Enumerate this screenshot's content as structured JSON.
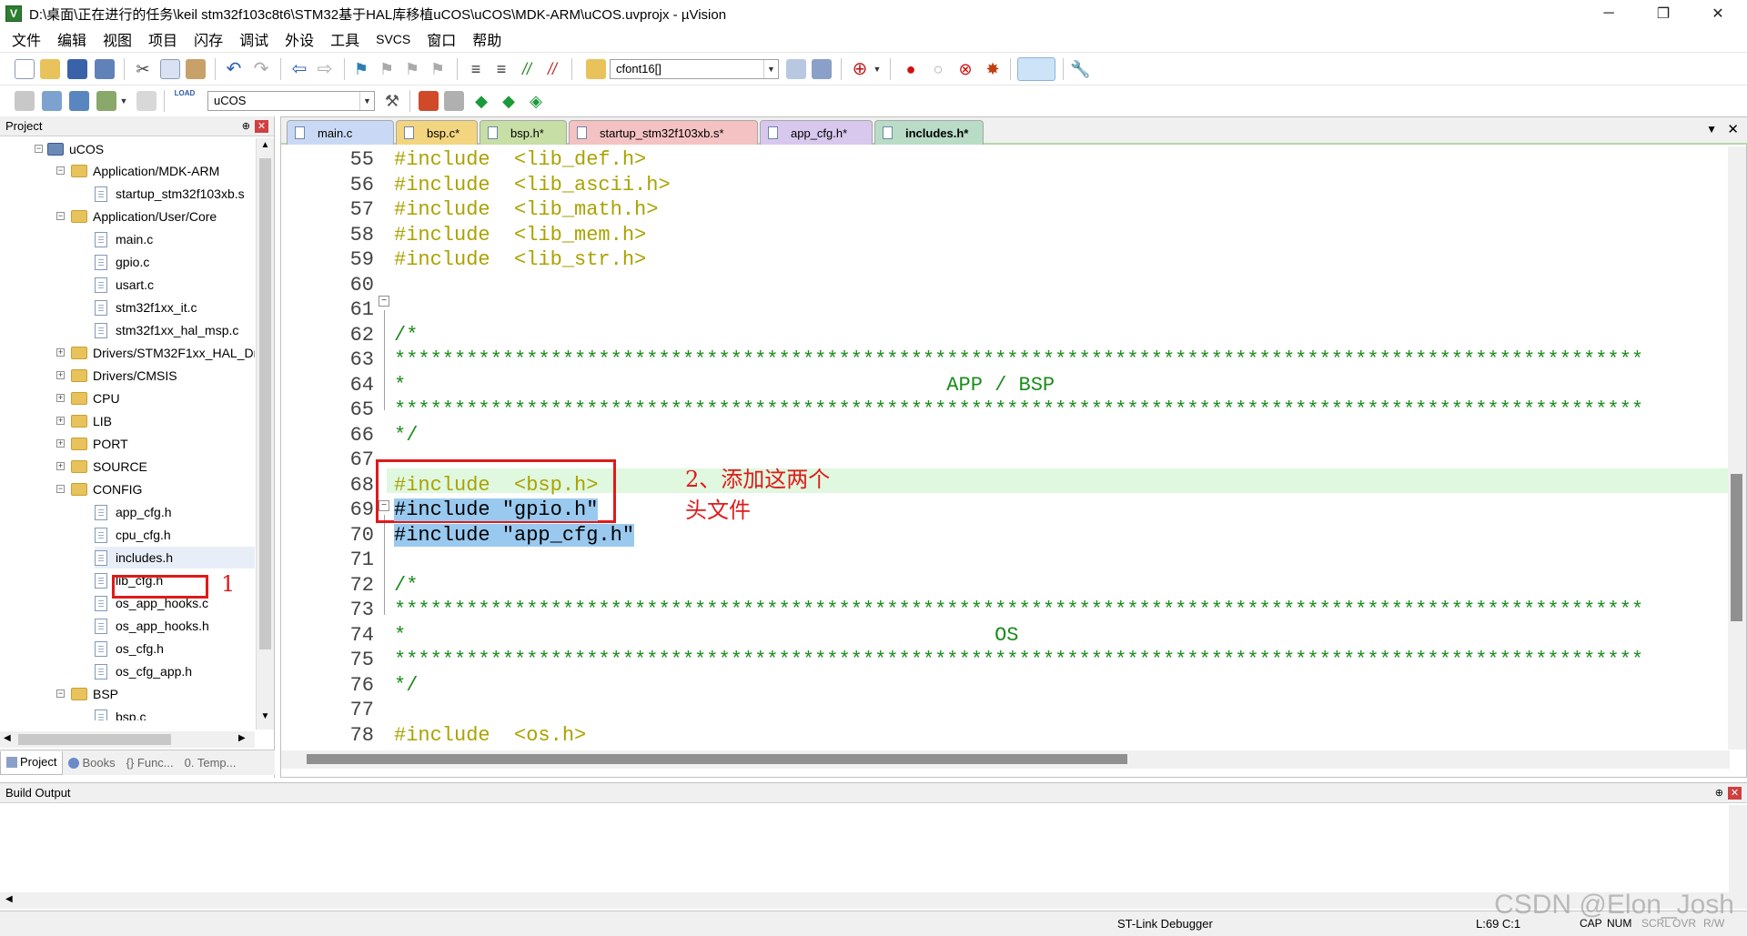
{
  "window": {
    "title": "D:\\桌面\\正在进行的任务\\keil stm32f103c8t6\\STM32基于HAL库移植uCOS\\uCOS\\MDK-ARM\\uCOS.uvprojx - µVision",
    "minimize": "─",
    "restore": "❐",
    "close": "✕"
  },
  "menu": [
    "文件",
    "编辑",
    "视图",
    "项目",
    "闪存",
    "调试",
    "外设",
    "工具",
    "SVCS",
    "窗口",
    "帮助"
  ],
  "toolbar": {
    "find_combo": "cfont16[]",
    "target_combo": "uCOS",
    "load_label": "LOAD"
  },
  "project_panel": {
    "title": "Project",
    "pin": "⊕",
    "close": "✕",
    "root": "uCOS",
    "tree": [
      {
        "type": "folder",
        "label": "Application/MDK-ARM",
        "expanded": true,
        "children": [
          "startup_stm32f103xb.s"
        ]
      },
      {
        "type": "folder",
        "label": "Application/User/Core",
        "expanded": true,
        "children": [
          "main.c",
          "gpio.c",
          "usart.c",
          "stm32f1xx_it.c",
          "stm32f1xx_hal_msp.c"
        ]
      },
      {
        "type": "folder",
        "label": "Drivers/STM32F1xx_HAL_Dr",
        "expanded": false
      },
      {
        "type": "folder",
        "label": "Drivers/CMSIS",
        "expanded": false
      },
      {
        "type": "folder",
        "label": "CPU",
        "expanded": false
      },
      {
        "type": "folder",
        "label": "LIB",
        "expanded": false
      },
      {
        "type": "folder",
        "label": "PORT",
        "expanded": false
      },
      {
        "type": "folder",
        "label": "SOURCE",
        "expanded": false
      },
      {
        "type": "folder",
        "label": "CONFIG",
        "expanded": true,
        "children": [
          "app_cfg.h",
          "cpu_cfg.h",
          "includes.h",
          "lib_cfg.h",
          "os_app_hooks.c",
          "os_app_hooks.h",
          "os_cfg.h",
          "os_cfg_app.h"
        ]
      },
      {
        "type": "folder",
        "label": "BSP",
        "expanded": true,
        "children": [
          "bsp.c"
        ]
      }
    ],
    "tabs": [
      "Project",
      "Books",
      "{} Func...",
      "0. Temp..."
    ]
  },
  "editor": {
    "tabs": [
      {
        "label": "main.c",
        "color": "#c9d9f5"
      },
      {
        "label": "bsp.c*",
        "color": "#f3d57f"
      },
      {
        "label": "bsp.h*",
        "color": "#c7dea6"
      },
      {
        "label": "startup_stm32f103xb.s*",
        "color": "#f4c2c2"
      },
      {
        "label": "app_cfg.h*",
        "color": "#d8c8ee"
      },
      {
        "label": "includes.h*",
        "color": "#b8dcc6",
        "active": true
      }
    ],
    "lines": [
      {
        "n": "55",
        "text": "#include  <lib_def.h>",
        "kind": "inc"
      },
      {
        "n": "56",
        "text": "#include  <lib_ascii.h>",
        "kind": "inc"
      },
      {
        "n": "57",
        "text": "#include  <lib_math.h>",
        "kind": "inc"
      },
      {
        "n": "58",
        "text": "#include  <lib_mem.h>",
        "kind": "inc"
      },
      {
        "n": "59",
        "text": "#include  <lib_str.h>",
        "kind": "inc"
      },
      {
        "n": "60",
        "text": "",
        "kind": "plain"
      },
      {
        "n": "61",
        "text": "",
        "kind": "plain"
      },
      {
        "n": "62",
        "text": "/*",
        "kind": "cmt"
      },
      {
        "n": "63",
        "text": "********************************************************************************************************",
        "kind": "cmt"
      },
      {
        "n": "64",
        "text": "*                                             APP / BSP",
        "kind": "cmt"
      },
      {
        "n": "65",
        "text": "********************************************************************************************************",
        "kind": "cmt"
      },
      {
        "n": "66",
        "text": "*/",
        "kind": "cmt"
      },
      {
        "n": "67",
        "text": "",
        "kind": "plain"
      },
      {
        "n": "68",
        "text": "#include  <bsp.h>",
        "kind": "inc"
      },
      {
        "n": "69",
        "text": "#include \"gpio.h\"",
        "kind": "sel"
      },
      {
        "n": "70",
        "text": "#include \"app_cfg.h\"",
        "kind": "sel"
      },
      {
        "n": "71",
        "text": "",
        "kind": "plain"
      },
      {
        "n": "72",
        "text": "/*",
        "kind": "cmt"
      },
      {
        "n": "73",
        "text": "********************************************************************************************************",
        "kind": "cmt"
      },
      {
        "n": "74",
        "text": "*                                                 OS",
        "kind": "cmt"
      },
      {
        "n": "75",
        "text": "********************************************************************************************************",
        "kind": "cmt"
      },
      {
        "n": "76",
        "text": "*/",
        "kind": "cmt"
      },
      {
        "n": "77",
        "text": "",
        "kind": "plain"
      },
      {
        "n": "78",
        "text": "#include  <os.h>",
        "kind": "inc"
      }
    ]
  },
  "annotations": {
    "one": "1",
    "two_line1": "2、添加这两个",
    "two_line2": "头文件"
  },
  "build_output": {
    "title": "Build Output",
    "pin": "⊕",
    "close": "✕"
  },
  "status": {
    "debugger": "ST-Link Debugger",
    "position": "L:69 C:1",
    "cap": "CAP",
    "num": "NUM",
    "scrl": "SCRL",
    "ovr": "OVR",
    "rw": "R/W"
  },
  "watermark": "CSDN @Elon_Josh"
}
